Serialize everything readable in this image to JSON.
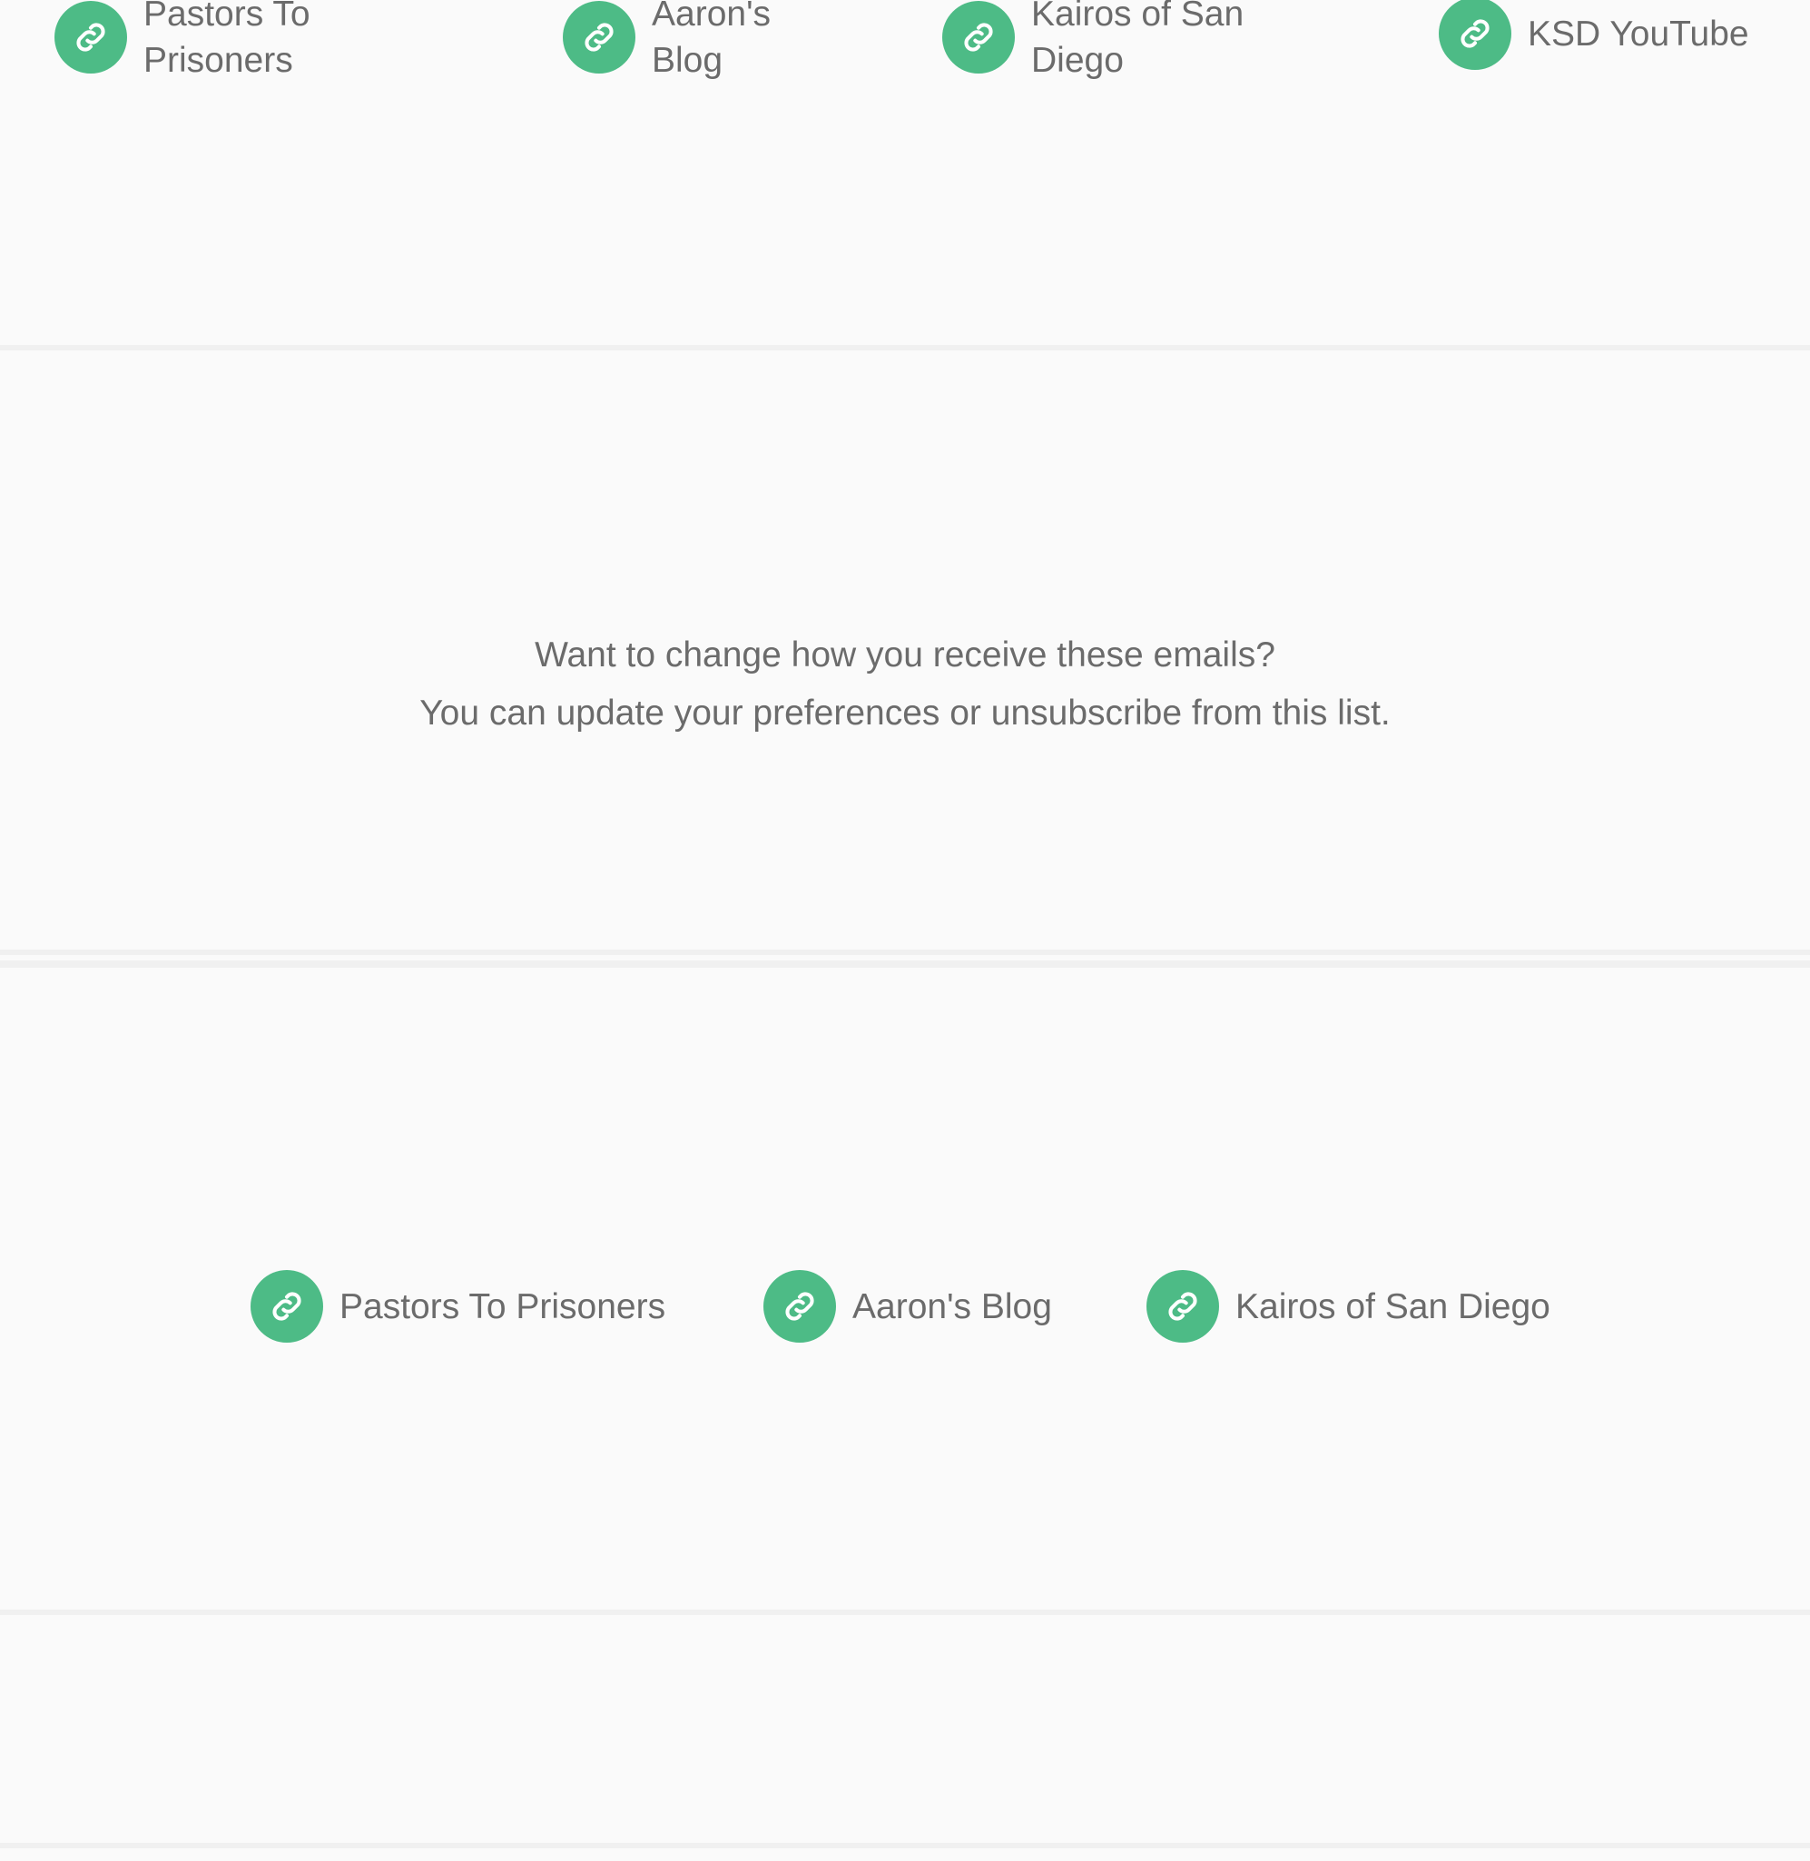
{
  "top_links": [
    {
      "label": "Pastors To Prisoners",
      "icon": "link-icon"
    },
    {
      "label": "Aaron's Blog",
      "icon": "link-icon"
    },
    {
      "label": "Kairos of San Diego",
      "icon": "link-icon"
    },
    {
      "label": "KSD YouTube",
      "icon": "link-icon"
    }
  ],
  "preferences": {
    "line1": "Want to change how you receive these emails?",
    "prefix": "You can ",
    "update_link": "update your preferences",
    "middle": " or ",
    "unsubscribe_link": "unsubscribe from this list",
    "suffix": "."
  },
  "bottom_links": [
    {
      "label": "Pastors To Prisoners",
      "icon": "link-icon"
    },
    {
      "label": "Aaron's Blog",
      "icon": "link-icon"
    },
    {
      "label": "Kairos of San Diego",
      "icon": "link-icon"
    }
  ],
  "colors": {
    "background": "#fafafa",
    "icon_accent": "#4dbb86",
    "text": "#6b6b6b",
    "divider": "#f0f0f0"
  }
}
